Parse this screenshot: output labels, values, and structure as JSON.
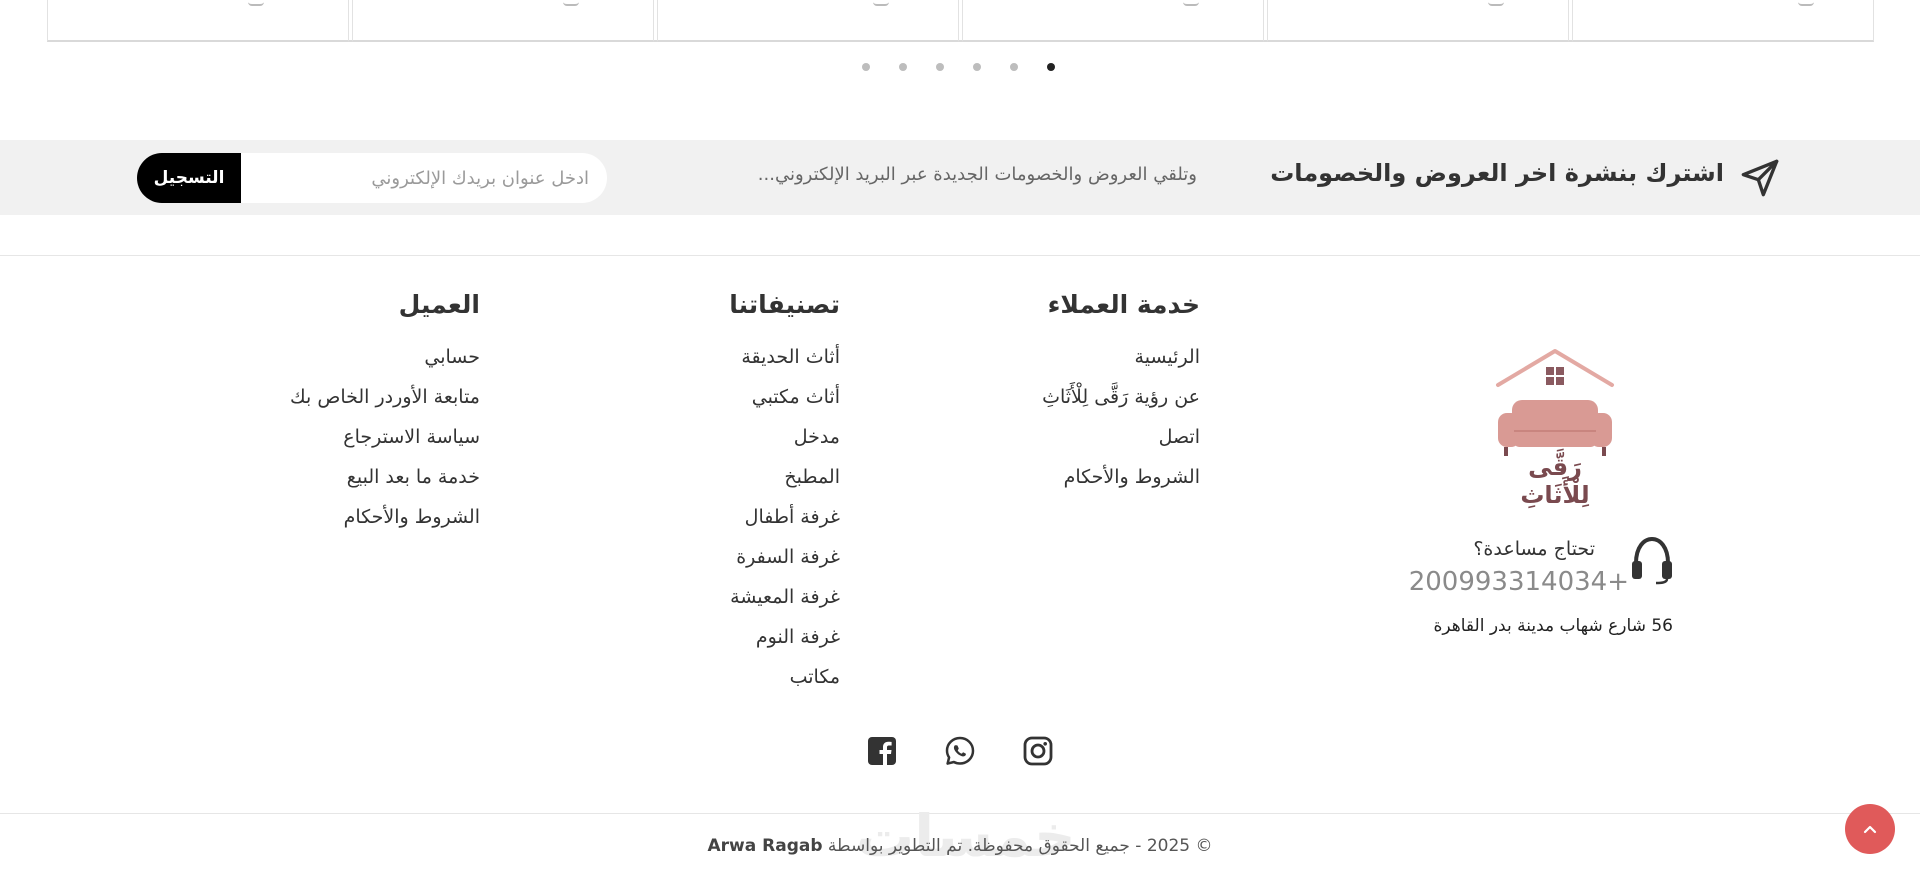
{
  "carousel": {
    "card_count": 6,
    "dot_count": 6,
    "active_dot": 6
  },
  "newsletter": {
    "icon": "send-icon",
    "title": "اشترك بنشرة اخر العروض والخصومات",
    "subtitle": "وتلقي العروض والخصومات الجديدة عبر البريد الإلكتروني...",
    "input_placeholder": "ادخل عنوان بريدك الإلكتروني",
    "button_label": "التسجيل"
  },
  "footer": {
    "customer_service": {
      "heading": "خدمة العملاء",
      "items": [
        "الرئيسية",
        "عن رؤية رَقَّى لِلْأَثَاثِ",
        "اتصل",
        "الشروط والأحكام"
      ]
    },
    "categories": {
      "heading": "تصنيفاتنا",
      "items": [
        "أثاث الحديقة",
        "أثاث مكتبي",
        "مدخل",
        "المطبخ",
        "غرفة أطفال",
        "غرفة السفرة",
        "غرفة المعيشة",
        "غرفة النوم",
        "مكاتب"
      ]
    },
    "client": {
      "heading": "العميل",
      "items": [
        "حسابي",
        "متابعة الأوردر الخاص بك",
        "سياسة الاسترجاع",
        "خدمة ما بعد البيع",
        "الشروط والأحكام"
      ]
    },
    "brand": {
      "logo_text": "رَقَّى لِلْأَثَاثِ",
      "help_label": "تحتاج مساعدة؟",
      "phone": "200993314034+",
      "address": "56 شارع شهاب مدينة بدر القاهرة"
    },
    "social": [
      "facebook-icon",
      "whatsapp-icon",
      "instagram-icon"
    ],
    "watermark": "خمسات",
    "copyright_prefix": "© 2025 - جميع الحقوق محفوظة. تم التطوير بواسطة ",
    "copyright_author": "Arwa Ragab"
  },
  "colors": {
    "accent": "#e05a5a",
    "logo_pink": "#d99a94",
    "logo_dark": "#7a4a4f",
    "newsletter_bg": "#f1f1f1",
    "button_bg": "#000000"
  }
}
